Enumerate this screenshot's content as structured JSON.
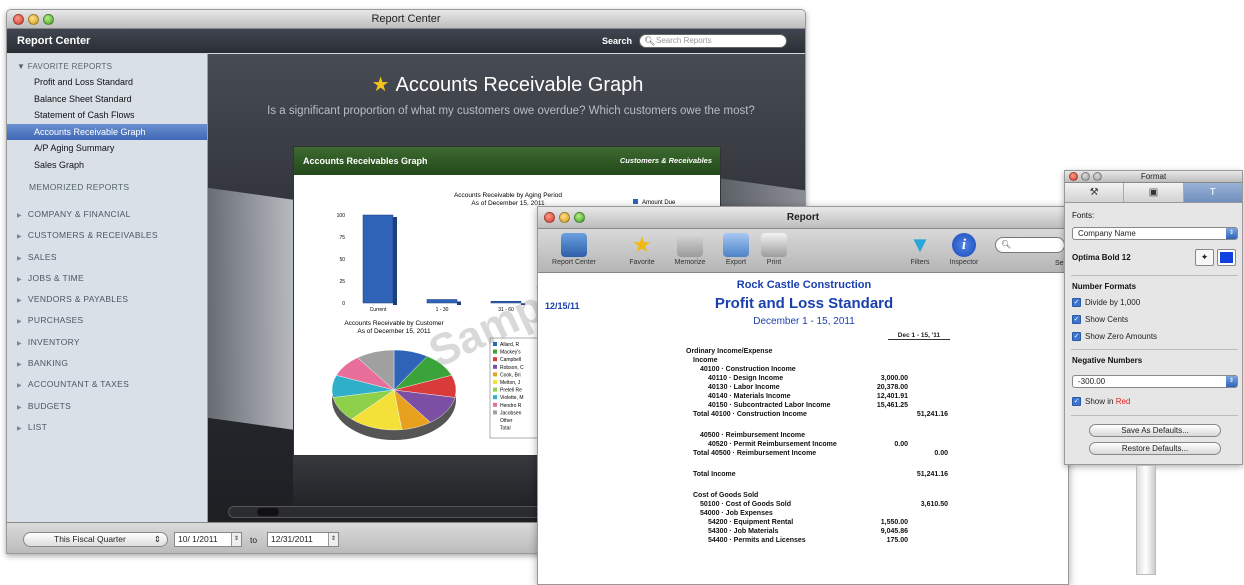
{
  "report_center": {
    "window_title": "Report Center",
    "header_title": "Report Center",
    "search_label": "Search",
    "search_placeholder": "Search Reports",
    "sidebar": {
      "favorites_header": "FAVORITE REPORTS",
      "favorites": [
        "Profit and Loss Standard",
        "Balance Sheet Standard",
        "Statement of Cash Flows",
        "Accounts Receivable Graph",
        "A/P Aging Summary",
        "Sales Graph"
      ],
      "memorized_header": "MEMORIZED REPORTS",
      "groups": [
        "COMPANY & FINANCIAL",
        "CUSTOMERS & RECEIVABLES",
        "SALES",
        "JOBS & TIME",
        "VENDORS & PAYABLES",
        "PURCHASES",
        "INVENTORY",
        "BANKING",
        "ACCOUNTANT & TAXES",
        "BUDGETS",
        "LIST"
      ]
    },
    "main": {
      "title": "Accounts Receivable Graph",
      "question": "Is a significant proportion of what my customers owe overdue? Which customers owe the most?",
      "card_title": "Accounts Receivables Graph",
      "card_category": "Customers & Receivables",
      "watermark": "Sample"
    },
    "footer": {
      "period": "This Fiscal Quarter",
      "from_date": "10/ 1/2011",
      "to_label": "to",
      "to_date": "12/31/2011"
    }
  },
  "chart_data": [
    {
      "type": "bar",
      "title": "Accounts Receivable by Aging Period",
      "subtitle": "As of December 15, 2011",
      "categories": [
        "Current",
        "1 - 30",
        "31 - 60"
      ],
      "series": [
        {
          "name": "Amount Due",
          "values": [
            100,
            4,
            2
          ]
        }
      ],
      "yticks": [
        "100",
        "75",
        "50",
        "25",
        "0"
      ],
      "ylim": [
        0,
        100
      ],
      "color": "#2f63b8"
    },
    {
      "type": "pie",
      "title": "Accounts Receivable by Customer",
      "subtitle": "As of December 15, 2011",
      "labels": [
        "Allard, R",
        "Mackey's",
        "Campbell",
        "Robson, C",
        "Cook, Bri",
        "Melton, J",
        "Pretell Re",
        "Violette, M",
        "Hendro R",
        "Jacobsen",
        "Other",
        "Total"
      ],
      "values": [
        9,
        10,
        9,
        12,
        8,
        14,
        10,
        9,
        9,
        10
      ],
      "colors": [
        "#2f63b8",
        "#3aa43a",
        "#d93a3a",
        "#7b4fa3",
        "#e8a01f",
        "#f3e13a",
        "#8fd04a",
        "#2fb0c8",
        "#e86f9a",
        "#a0a0a0"
      ]
    }
  ],
  "report": {
    "window_title": "Report",
    "toolbar": [
      "Report Center",
      "Favorite",
      "Memorize",
      "Export",
      "Print",
      "Filters",
      "Inspector"
    ],
    "search_value": "",
    "search_label_partial": "Se",
    "date": "12/15/11",
    "company": "Rock Castle Construction",
    "title": "Profit and Loss Standard",
    "range": "December 1 - 15, 2011",
    "col_header": "Dec 1 - 15, '11",
    "lines": [
      {
        "label": "Ordinary Income/Expense",
        "value": ""
      },
      {
        "label": "Income",
        "value": ""
      },
      {
        "label": "40100 · Construction Income",
        "value": ""
      },
      {
        "label": "40110 · Design Income",
        "value": "3,000.00"
      },
      {
        "label": "40130 · Labor Income",
        "value": "20,378.00"
      },
      {
        "label": "40140 · Materials Income",
        "value": "12,401.91"
      },
      {
        "label": "40150 · Subcontracted Labor Income",
        "value": "15,461.25"
      },
      {
        "label": "Total 40100 · Construction Income",
        "value": "51,241.16"
      },
      {
        "label": "40500 · Reimbursement Income",
        "value": ""
      },
      {
        "label": "40520 · Permit Reimbursement Income",
        "value": "0.00"
      },
      {
        "label": "Total 40500 · Reimbursement Income",
        "value": "0.00"
      },
      {
        "label": "Total Income",
        "value": "51,241.16"
      },
      {
        "label": "Cost of Goods Sold",
        "value": ""
      },
      {
        "label": "50100 · Cost of Goods Sold",
        "value": "3,610.50"
      },
      {
        "label": "54000 · Job Expenses",
        "value": ""
      },
      {
        "label": "54200 · Equipment Rental",
        "value": "1,550.00"
      },
      {
        "label": "54300 · Job Materials",
        "value": "9,045.86"
      },
      {
        "label": "54400 · Permits and Licenses",
        "value": "175.00"
      }
    ]
  },
  "format_palette": {
    "window_title": "Format",
    "fonts_label": "Fonts:",
    "font_target": "Company Name",
    "font_name": "Optima Bold 12",
    "number_formats_label": "Number Formats",
    "divide_label": "Divide by 1,000",
    "cents_label": "Show Cents",
    "zero_label": "Show Zero Amounts",
    "negative_label": "Negative Numbers",
    "negative_value": "-300.00",
    "show_in": "Show in",
    "red": "Red",
    "save_btn": "Save As Defaults...",
    "restore_btn": "Restore Defaults...",
    "color_swatch": "#1041e0"
  }
}
